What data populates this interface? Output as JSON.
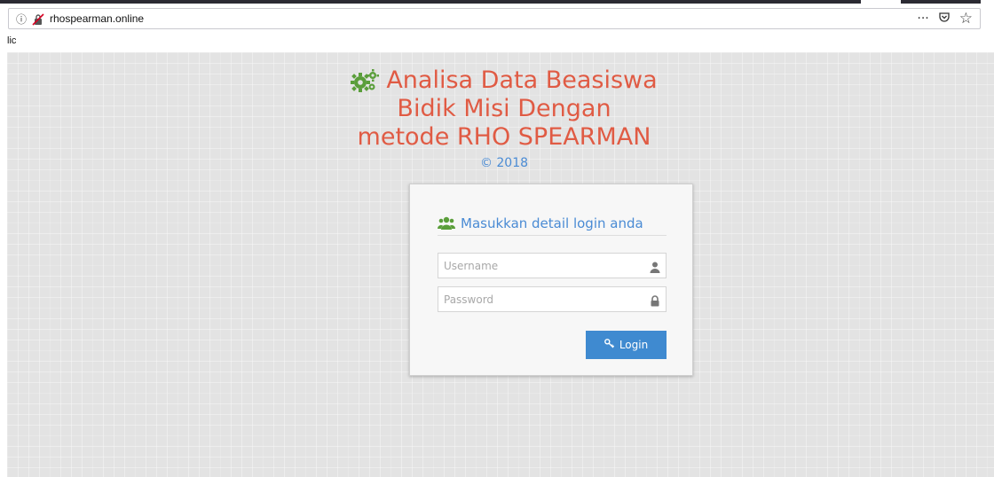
{
  "browser": {
    "url": "rhospearman.online",
    "status_text": "lic",
    "menu_glyph": "···",
    "pocket_glyph": "⧩",
    "star_glyph": "☆",
    "info_glyph": "ⓘ"
  },
  "header": {
    "title_line1": "Analisa Data Beasiswa",
    "title_line2": "Bidik Misi Dengan",
    "title_line3": "metode RHO SPEARMAN",
    "copyright": "© 2018",
    "icon": "cogs-icon"
  },
  "login": {
    "title": "Masukkan detail login anda",
    "title_icon": "users-icon",
    "username_placeholder": "Username",
    "username_value": "",
    "username_icon": "user-icon",
    "password_placeholder": "Password",
    "password_value": "",
    "password_icon": "lock-icon",
    "button_label": "Login",
    "button_icon": "key-icon"
  },
  "colors": {
    "title": "#e05b44",
    "accent_blue": "#4a8bd4",
    "button": "#3f8ad0",
    "icon_green": "#5a9e3a",
    "background": "#e3e3e3"
  }
}
